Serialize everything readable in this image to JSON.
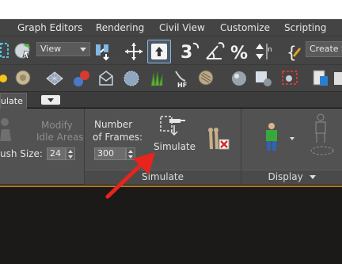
{
  "menu": {
    "items": [
      "Graph Editors",
      "Rendering",
      "Civil View",
      "Customize",
      "Scripting"
    ]
  },
  "toolbar": {
    "view_select": "View",
    "create_select": "Create S",
    "icons": [
      "select-region-icon",
      "select-object-icon",
      "select-link-icon",
      "move-icon",
      "select-tool-icon",
      "snap-3d-icon",
      "angle-snap-icon",
      "percent-snap-icon",
      "spinner-snap-icon",
      "edit-named-selection-icon",
      "sun-icon",
      "sphere-icon",
      "mesh-grid-icon",
      "material-ball-icon",
      "envelope-icon",
      "gear-object-icon",
      "grass-icon",
      "hair-fur-icon",
      "hatch-icon",
      "render-sphere-icon",
      "render-setup-icon",
      "render-frame-icon",
      "scene-explorer-icon",
      "layer-manager-icon"
    ]
  },
  "ribbon": {
    "active_tab": "ulate",
    "modify_idle_areas": [
      "Modify",
      "Idle Areas"
    ],
    "brush_size_label": "ush Size:",
    "brush_size_value": "24",
    "number_of_frames_label": [
      "Number",
      "of Frames:"
    ],
    "frames_value": "300",
    "simulate_label": "Simulate",
    "panels": {
      "simulate": "Simulate",
      "display": "Display"
    }
  },
  "annotation": {
    "arrow_color": "#e8241c"
  },
  "colors": {
    "accent_orange": "#b07a1a",
    "selected_tool_border": "#8bb4e0"
  }
}
